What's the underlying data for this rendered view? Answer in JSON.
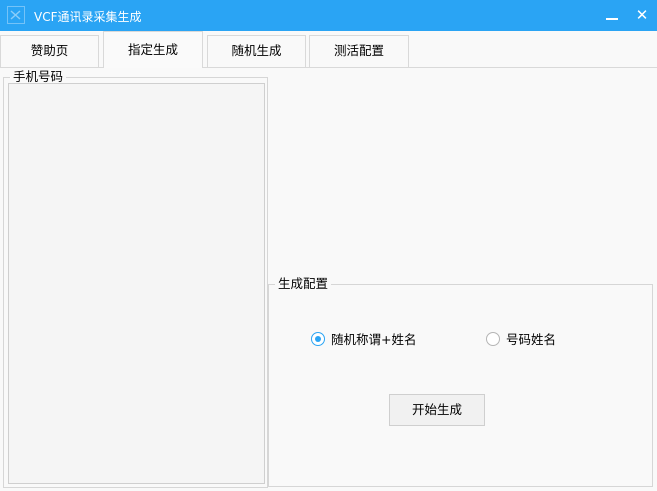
{
  "window": {
    "title": "VCF通讯录采集生成",
    "icon": "app-icon",
    "minimize_label": "_",
    "close_label": "✕",
    "accent_color": "#2aa4f4"
  },
  "tabs": [
    {
      "label": "赞助页",
      "active": false
    },
    {
      "label": "指定生成",
      "active": true
    },
    {
      "label": "随机生成",
      "active": false
    },
    {
      "label": "测活配置",
      "active": false
    }
  ],
  "phone_group": {
    "legend": "手机号码",
    "value": ""
  },
  "config_group": {
    "legend": "生成配置",
    "options": [
      {
        "label": "随机称谓+姓名",
        "selected": true
      },
      {
        "label": "号码姓名",
        "selected": false
      }
    ],
    "start_button": "开始生成"
  }
}
